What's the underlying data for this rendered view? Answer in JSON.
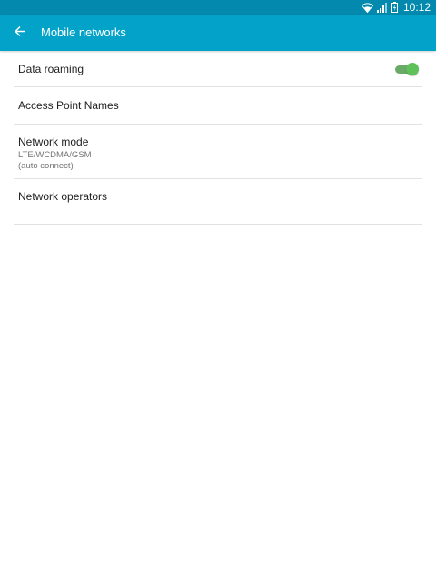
{
  "status_bar": {
    "time": "10:12",
    "icons": [
      "wifi-icon",
      "signal-icon",
      "battery-icon"
    ]
  },
  "app_bar": {
    "back_icon": "arrow-left-icon",
    "title": "Mobile networks"
  },
  "settings": {
    "data_roaming": {
      "title": "Data roaming",
      "enabled": true
    },
    "apn": {
      "title": "Access Point Names"
    },
    "network_mode": {
      "title": "Network mode",
      "summary_line1": "LTE/WCDMA/GSM",
      "summary_line2": "(auto connect)"
    },
    "network_operators": {
      "title": "Network operators"
    }
  },
  "colors": {
    "status_bar": "#0289ad",
    "app_bar": "#03a3c9",
    "toggle_on": "#5fc15a"
  }
}
